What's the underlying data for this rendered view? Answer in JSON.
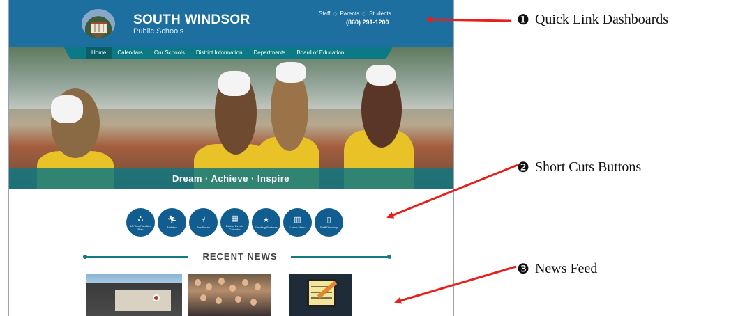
{
  "header": {
    "school_name": "SOUTH WINDSOR",
    "school_subtitle": "Public Schools",
    "quick_links": [
      "Staff",
      "Parents",
      "Students"
    ],
    "phone": "(860) 291-1200",
    "brand_color": "#1d6fa0"
  },
  "nav": {
    "items": [
      "Home",
      "Calendars",
      "Our Schools",
      "District Information",
      "Departments",
      "Board of Education"
    ],
    "active": "Home",
    "color": "#0b7a86"
  },
  "hero": {
    "tagline": "Dream · Achieve · Inspire"
  },
  "shortcuts": [
    {
      "label": "10-Year Facilities Plan",
      "icon": "school-icon"
    },
    {
      "label": "Athletics",
      "icon": "runner-icon"
    },
    {
      "label": "Bus Route",
      "icon": "route-icon"
    },
    {
      "label": "District Events Calendar",
      "icon": "calendar-icon"
    },
    {
      "label": "Enrolling Students",
      "icon": "star-icon"
    },
    {
      "label": "Lunch Menu",
      "icon": "book-icon"
    },
    {
      "label": "Staff Directory",
      "icon": "directory-icon"
    }
  ],
  "news": {
    "title": "RECENT NEWS"
  },
  "annotations": [
    {
      "number": "❶",
      "text": "Quick Link Dashboards"
    },
    {
      "number": "❷",
      "text": "Short Cuts Buttons"
    },
    {
      "number": "❸",
      "text": "News Feed"
    }
  ],
  "arrow_color": "#e8201c"
}
